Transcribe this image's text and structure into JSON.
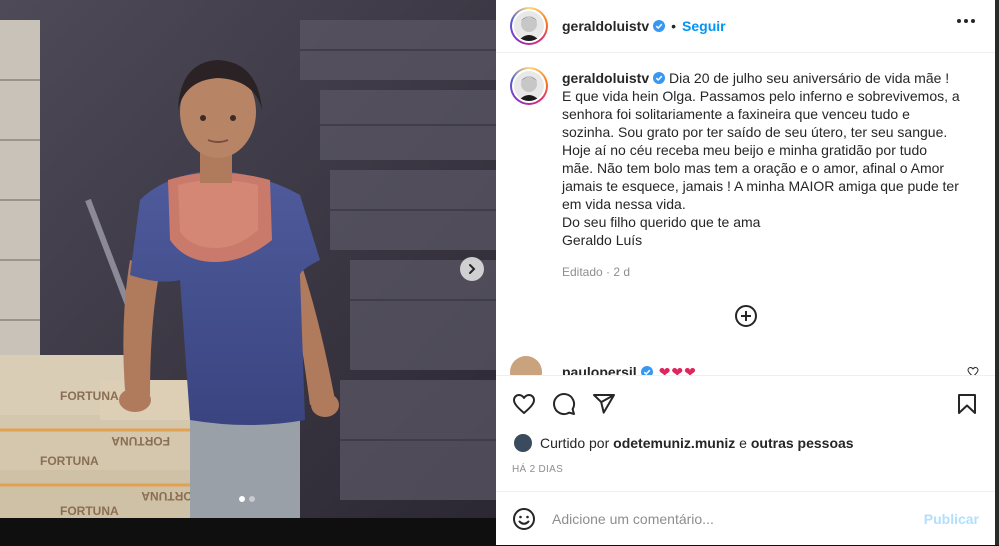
{
  "post": {
    "username": "geraldoluistv",
    "follow_label": "Seguir",
    "separator": "•",
    "caption_user": "geraldoluistv",
    "caption": "Dia 20 de julho seu aniversário de vida mãe ! E que vida hein Olga. Passamos pelo inferno e sobrevivemos, a senhora foi solitariamente a faxineira que venceu tudo e sozinha. Sou grato por ter saído de seu útero, ter seu sangue. Hoje aí no céu receba meu beijo e minha gratidão por tudo mãe. Não tem bolo mas tem a oração e o amor, afinal o Amor jamais te esquece, jamais ! A minha MAIOR amiga que pude ter em vida nessa vida.\nDo seu filho querido que te ama\nGeraldo Luís",
    "edited": "Editado · 2 d",
    "comment2_user": "paulopersil",
    "comment2_hearts": "❤❤❤",
    "liked_by_prefix": "Curtido por",
    "liked_by_user": "odetemuniz.muniz",
    "liked_by_suffix": "e",
    "liked_by_others": "outras pessoas",
    "time_ago": "HÁ 2 DIAS",
    "comment_placeholder": "Adicione um comentário...",
    "publish_label": "Publicar"
  },
  "media": {
    "carousel_index": 1,
    "carousel_total": 2
  },
  "colors": {
    "accent": "#0095f6",
    "publish_disabled": "#b2dffc",
    "verified": "#3897f0",
    "heart": "#e0245e"
  },
  "icons": [
    "verified-badge-icon",
    "more-options-icon",
    "chevron-right-icon",
    "add-circle-icon",
    "heart-icon",
    "comment-icon",
    "share-icon",
    "bookmark-icon",
    "emoji-icon"
  ]
}
